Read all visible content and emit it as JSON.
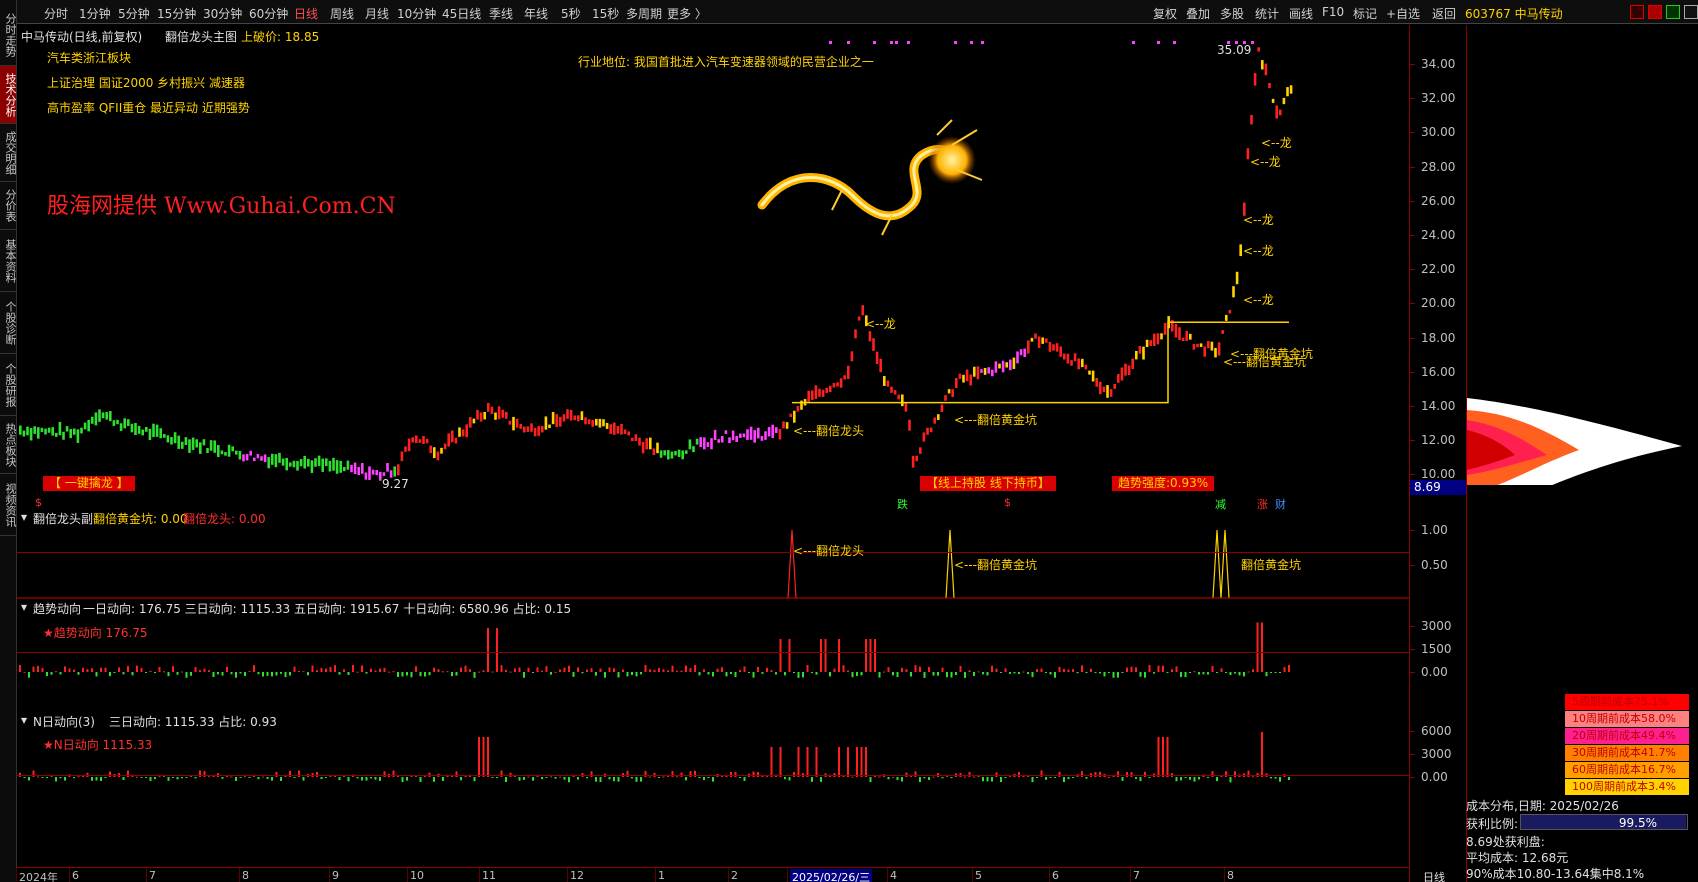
{
  "left_tabs": [
    "分时走势",
    "技术分析",
    "成交明细",
    "分价表",
    "基本资料",
    "个股诊断",
    "个股研报",
    "热点板块",
    "视频资讯"
  ],
  "left_tab_active": 1,
  "toolbar": {
    "periods": [
      "分时",
      "1分钟",
      "5分钟",
      "15分钟",
      "30分钟",
      "60分钟",
      "日线",
      "周线",
      "月线",
      "10分钟",
      "45日线",
      "季线",
      "年线",
      "5秒",
      "15秒",
      "多周期",
      "更多 〉"
    ],
    "active_period": 6,
    "right_items": [
      "复权",
      "叠加",
      "多股",
      "统计",
      "画线",
      "F10",
      "标记",
      "+自选",
      "返回"
    ],
    "stock": "603767 中马传动"
  },
  "main_panel": {
    "title": "中马传动(日线,前复权)",
    "indicator_name": "翻倍龙头主图",
    "indicator_value": "上破价: 18.85",
    "sector": "汽车类浙江板块",
    "tags1": "上证治理 国证2000 乡村振兴 减速器",
    "tags2": "高市盈率 QFII重仓 最近异动 近期强势",
    "position_note": "行业地位: 我国首批进入汽车变速器领域的民营企业之一",
    "watermark": "股海网提供 Www.Guhai.Com.CN",
    "high_label": "35.09",
    "low_label": "9.27",
    "arrow_long": "<---翻倍龙头",
    "arrow_golden": "<---翻倍黄金坑",
    "arrow_dragon": "<--龙",
    "box_left": "【 一键擒龙 】",
    "box_mid": "【线上持股 线下持币】",
    "box_trend": "趋势强度:0.93%",
    "current_price": "8.69",
    "events": [
      "跌",
      "减",
      "涨",
      "财"
    ],
    "yticks": [
      "34.00",
      "32.00",
      "30.00",
      "28.00",
      "26.00",
      "24.00",
      "22.00",
      "20.00",
      "18.00",
      "16.00",
      "14.00",
      "12.00",
      "10.00"
    ]
  },
  "sub1": {
    "name": "翻倍龙头副",
    "item1": "翻倍黄金坑: 0.00",
    "item2": "翻倍龙头: 0.00",
    "yticks": [
      "1.00",
      "0.50"
    ],
    "label_long": "<---翻倍龙头",
    "label_golden": "<---翻倍黄金坑",
    "label_overlap": "翻倍黄金坑"
  },
  "sub2": {
    "name": "趋势动向",
    "values": "一日动向: 176.75 三日动向: 1115.33 五日动向: 1915.67 十日动向: 6580.96 占比: 0.15",
    "star": "★趋势动向 176.75",
    "yticks": [
      "3000",
      "1500",
      "0.00"
    ]
  },
  "sub3": {
    "name": "N日动向(3)",
    "values": "三日动向: 1115.33 占比: 0.93",
    "star": "★N日动向 1115.33",
    "yticks": [
      "6000",
      "3000",
      "0.00"
    ]
  },
  "x_axis": {
    "labels": [
      "2024年",
      "6",
      "7",
      "8",
      "9",
      "10",
      "11",
      "12",
      "1",
      "2",
      "2025/02/26/三",
      "4",
      "5",
      "6",
      "7",
      "8"
    ],
    "right_label": "日线"
  },
  "right_panel": {
    "cost_rows": [
      {
        "label": "5周期前成本75.1%",
        "color": "#ff0000"
      },
      {
        "label": "10周期前成本58.0%",
        "color": "#ff8080"
      },
      {
        "label": "20周期前成本49.4%",
        "color": "#ff2090"
      },
      {
        "label": "30周期前成本41.7%",
        "color": "#ff8000"
      },
      {
        "label": "60周期前成本16.7%",
        "color": "#ffa000"
      },
      {
        "label": "100周期前成本3.4%",
        "color": "#ffd200"
      }
    ],
    "cost_date": "成本分布,日期: 2025/02/26",
    "profit_label": "获利比例:",
    "profit_value": "99.5%",
    "profit_at": "8.69处获利盘:",
    "avg_cost": "平均成本: 12.68元",
    "range_90": "90%成本10.80-13.64集中8.1%"
  }
}
